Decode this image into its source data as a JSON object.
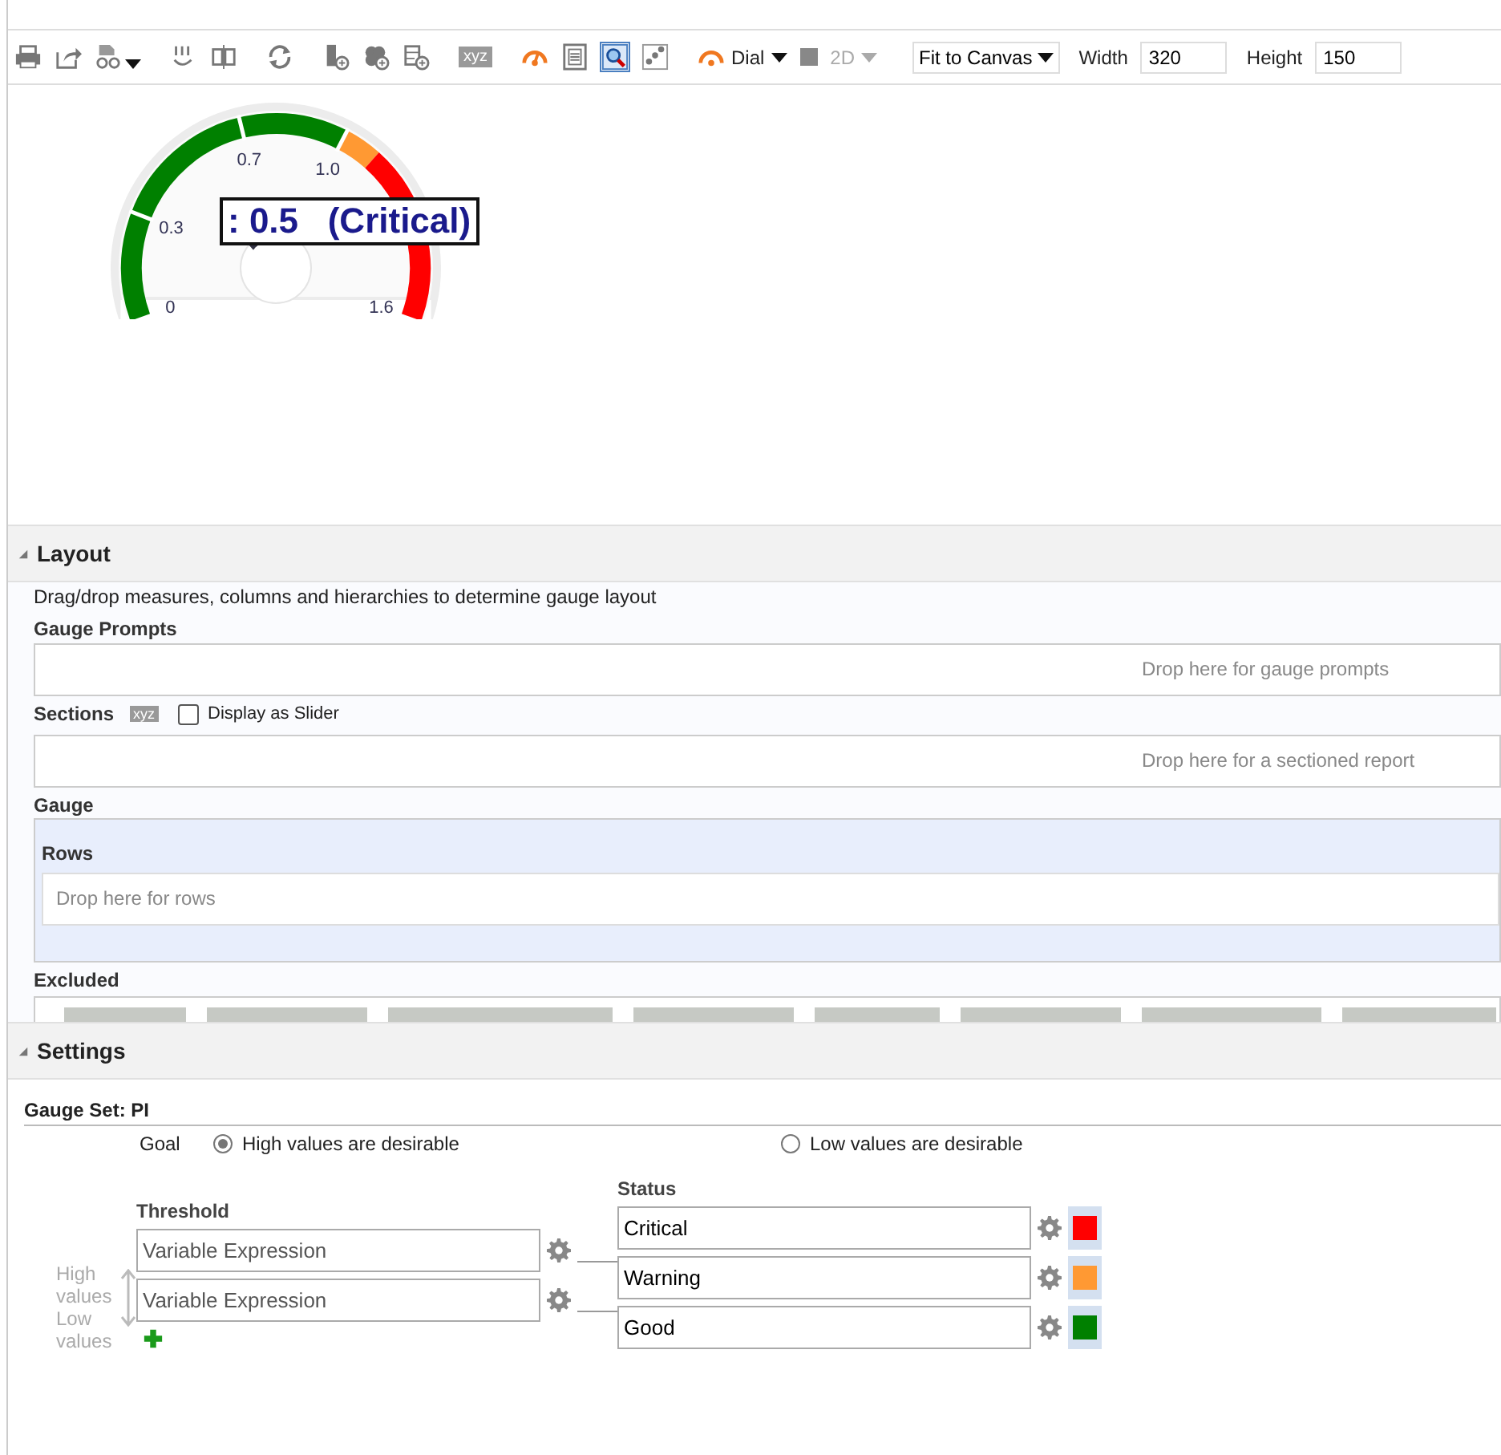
{
  "toolbar": {
    "xyz_badge": "xyz",
    "zoom_selected": true,
    "chart_type": "Dial",
    "dimension": {
      "label": "2D",
      "disabled": true
    },
    "fit": "Fit to Canvas",
    "width_label": "Width",
    "width_value": "320",
    "height_label": "Height",
    "height_value": "150"
  },
  "gauge": {
    "ticks": [
      "0",
      "0.3",
      "0.7",
      "1.0",
      "1.6"
    ],
    "tooltip": ": 0.5   (Critical)"
  },
  "layout": {
    "title": "Layout",
    "expanded": true,
    "hint": "Drag/drop measures, columns and hierarchies to determine gauge layout",
    "prompts_label": "Gauge Prompts",
    "prompts_drop": "Drop here for gauge prompts",
    "sections_label": "Sections",
    "sections_badge": "xyz",
    "slider_label": "Display as Slider",
    "slider_checked": false,
    "sections_drop": "Drop here for a sectioned report",
    "gauge_label": "Gauge",
    "rows_label": "Rows",
    "rows_drop": "Drop here for rows",
    "excluded_label": "Excluded"
  },
  "settings": {
    "title": "Settings",
    "expanded": true,
    "gauge_set": "Gauge Set: PI",
    "goal_label": "Goal",
    "goals": [
      {
        "label": "High values are desirable",
        "selected": true
      },
      {
        "label": "Low values are desirable",
        "selected": false
      }
    ],
    "threshold_label": "Threshold",
    "status_label": "Status",
    "high_label": "High values",
    "low_label": "Low values",
    "thresholds": [
      {
        "value": "Variable Expression"
      },
      {
        "value": "Variable Expression"
      }
    ],
    "statuses": [
      {
        "value": "Critical",
        "color": "#ff0000"
      },
      {
        "value": "Warning",
        "color": "#ff9933"
      },
      {
        "value": "Good",
        "color": "#008000"
      }
    ]
  }
}
